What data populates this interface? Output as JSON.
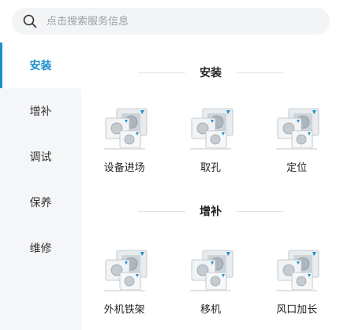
{
  "search": {
    "placeholder": "点击搜索服务信息"
  },
  "sidebar": {
    "items": [
      {
        "label": "安装"
      },
      {
        "label": "增补"
      },
      {
        "label": "调试"
      },
      {
        "label": "保养"
      },
      {
        "label": "维修"
      }
    ],
    "active_index": 0
  },
  "sections": [
    {
      "title": "安装",
      "items": [
        {
          "label": "设备进场",
          "icon": "ac-unit-icon"
        },
        {
          "label": "取孔",
          "icon": "ac-unit-icon"
        },
        {
          "label": "定位",
          "icon": "ac-unit-icon"
        }
      ]
    },
    {
      "title": "增补",
      "items": [
        {
          "label": "外机铁架",
          "icon": "ac-unit-icon"
        },
        {
          "label": "移机",
          "icon": "ac-unit-icon"
        },
        {
          "label": "风口加长",
          "icon": "ac-unit-icon"
        }
      ]
    }
  ],
  "colors": {
    "accent": "#1a8fc9",
    "sidebar_bg": "#f5f6f8",
    "search_bg": "#f3f4f6"
  }
}
